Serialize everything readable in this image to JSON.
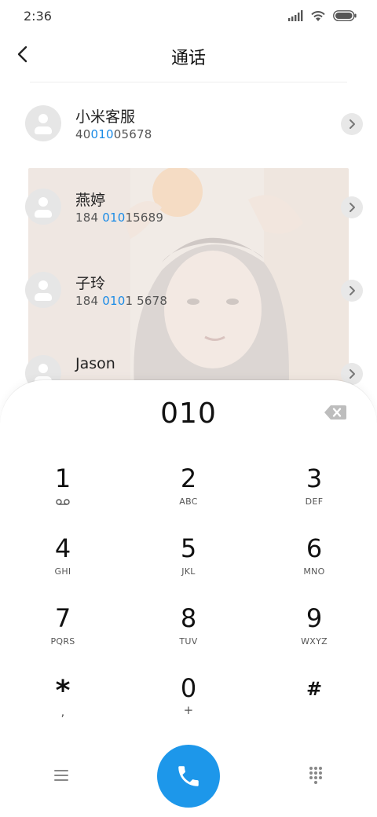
{
  "status": {
    "time": "2:36"
  },
  "header": {
    "title": "通话"
  },
  "contacts": [
    {
      "name": "小米客服",
      "num_parts": [
        "40",
        "010",
        "05678"
      ]
    },
    {
      "name": "燕婷",
      "num_parts": [
        "184 ",
        "010",
        "15689"
      ]
    },
    {
      "name": "子玲",
      "num_parts": [
        "184 ",
        "010",
        "1 5678"
      ]
    },
    {
      "name": "Jason",
      "num_parts": [
        "",
        "",
        ""
      ]
    }
  ],
  "dialer": {
    "typed_number": "010",
    "keys": [
      {
        "digit": "1",
        "letters": ""
      },
      {
        "digit": "2",
        "letters": "ABC"
      },
      {
        "digit": "3",
        "letters": "DEF"
      },
      {
        "digit": "4",
        "letters": "GHI"
      },
      {
        "digit": "5",
        "letters": "JKL"
      },
      {
        "digit": "6",
        "letters": "MNO"
      },
      {
        "digit": "7",
        "letters": "PQRS"
      },
      {
        "digit": "8",
        "letters": "TUV"
      },
      {
        "digit": "9",
        "letters": "WXYZ"
      },
      {
        "digit": "*",
        "letters": ","
      },
      {
        "digit": "0",
        "letters": "+"
      },
      {
        "digit": "#",
        "letters": ""
      }
    ]
  },
  "colors": {
    "accent": "#1a8be6",
    "call_button": "#1d97ea"
  },
  "icons": {
    "signal": "signal-icon",
    "wifi": "wifi-icon",
    "battery": "battery-icon",
    "back": "chevron-left-icon",
    "row_arrow": "chevron-right-icon",
    "voicemail": "voicemail-icon",
    "backspace": "backspace-icon",
    "menu": "menu-icon",
    "call": "phone-icon",
    "dialpad": "dialpad-icon"
  }
}
